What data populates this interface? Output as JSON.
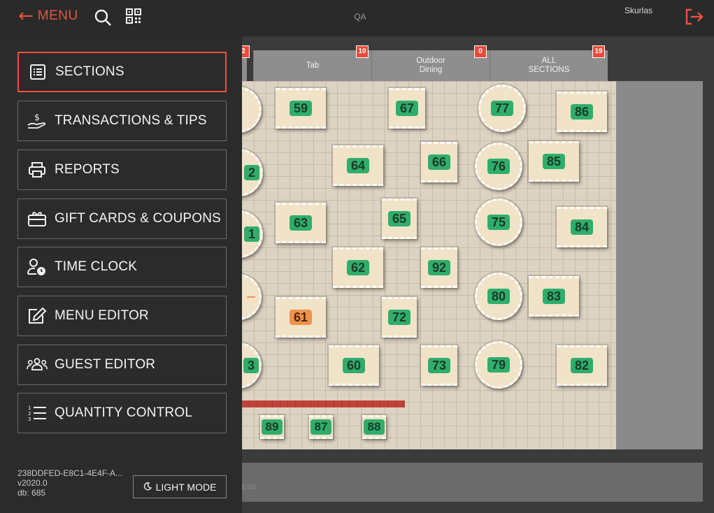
{
  "topbar": {
    "menu_label": "MENU",
    "back_arrow": "←",
    "location": "QA",
    "user": "Skurlas",
    "icons": [
      "arrow-left-icon",
      "search-icon",
      "qr-code-icon",
      "logout-icon"
    ]
  },
  "tabs": [
    {
      "label": "",
      "count": "2"
    },
    {
      "label": "Tab",
      "count": "10"
    },
    {
      "label": "Outdoor\nDining",
      "count": "0"
    },
    {
      "label": "ALL\nSECTIONS",
      "count": "19"
    }
  ],
  "tables": [
    "59",
    "67",
    "77",
    "86",
    "64",
    "66",
    "76",
    "85",
    "63",
    "65",
    "75",
    "84",
    "62",
    "92",
    "61",
    "72",
    "80",
    "83",
    "60",
    "73",
    "79",
    "82",
    "89",
    "87",
    "88"
  ],
  "partial_tables": [
    "2",
    "1",
    "3"
  ],
  "bottom_hint": "ESS",
  "drawer": {
    "items": [
      {
        "label": "SECTIONS",
        "icon": "list-icon"
      },
      {
        "label": "TRANSACTIONS & TIPS",
        "icon": "hand-money-icon"
      },
      {
        "label": "REPORTS",
        "icon": "printer-icon"
      },
      {
        "label": "GIFT CARDS & COUPONS",
        "icon": "gift-icon"
      },
      {
        "label": "TIME CLOCK",
        "icon": "user-clock-icon"
      },
      {
        "label": "MENU EDITOR",
        "icon": "edit-icon"
      },
      {
        "label": "GUEST EDITOR",
        "icon": "users-icon"
      },
      {
        "label": "QUANTITY CONTROL",
        "icon": "numbered-list-icon"
      }
    ],
    "device_id": "238DDFED-E8C1-4E4F-A...",
    "version": "v2020.0",
    "db": "db: 685",
    "light_mode_label": "LIGHT MODE"
  },
  "colors": {
    "accent": "#e8533e",
    "table_free": "#2fae6b",
    "table_busy": "#f0924b",
    "badge": "#e74c3c"
  }
}
